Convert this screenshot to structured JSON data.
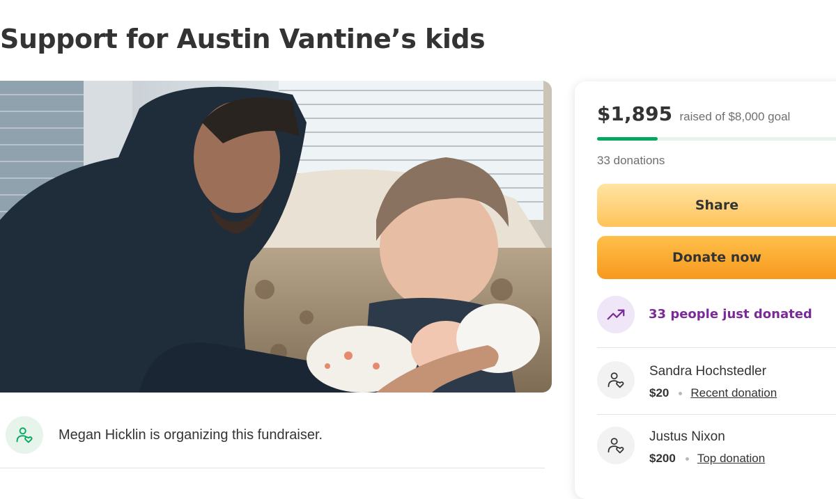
{
  "page": {
    "title": "Support for Austin Vantine’s kids"
  },
  "organizer": {
    "text": "Megan Hicklin is organizing this fundraiser.",
    "icon": "person-heart-icon"
  },
  "donation_panel": {
    "amount_raised": "$1,895",
    "goal_text": "raised of $8,000 goal",
    "progress_fraction": 0.237,
    "donation_count": "33 donations",
    "share_label": "Share",
    "donate_label": "Donate now",
    "trend_text": "33 people just donated",
    "trend_icon": "trending-up-icon",
    "donors": [
      {
        "name": "Sandra Hochstedler",
        "amount": "$20",
        "tag": "Recent donation"
      },
      {
        "name": "Justus Nixon",
        "amount": "$200",
        "tag": "Top donation"
      }
    ]
  },
  "colors": {
    "progress": "#02a95c",
    "share_button": "#ffc35a",
    "donate_button": "#f7981d",
    "trend_text": "#7a2b97"
  }
}
